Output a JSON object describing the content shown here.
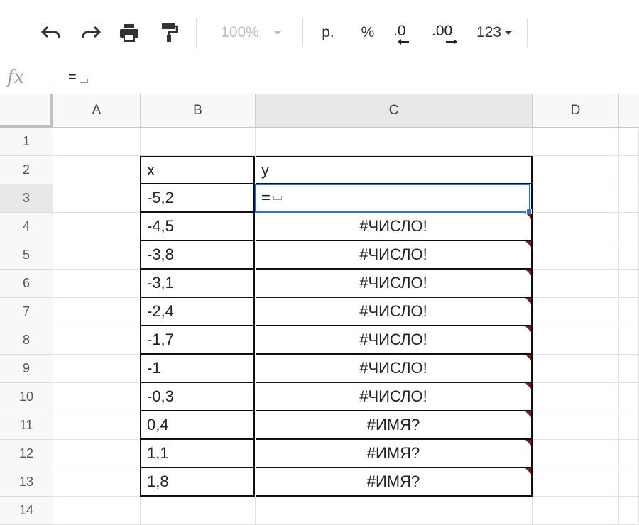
{
  "toolbar": {
    "undo_icon": "undo-icon",
    "redo_icon": "redo-icon",
    "print_icon": "print-icon",
    "paint_format_icon": "paint-format-icon",
    "zoom_label": "100%",
    "currency_label": "р.",
    "percent_label": "%",
    "decrease_decimal_label": ".0",
    "increase_decimal_label": ".00",
    "more_formats_label": "123"
  },
  "formula_bar": {
    "fx_label": "fx",
    "content": "="
  },
  "columns": [
    "A",
    "B",
    "C",
    "D"
  ],
  "rows": [
    "1",
    "2",
    "3",
    "4",
    "5",
    "6",
    "7",
    "8",
    "9",
    "10",
    "11",
    "12",
    "13",
    "14"
  ],
  "table": {
    "header_x": "x",
    "header_y": "y",
    "x_values": [
      "-5,2",
      "-4,5",
      "-3,8",
      "-3,1",
      "-2,4",
      "-1,7",
      "-1",
      "-0,3",
      "0,4",
      "1,1",
      "1,8"
    ],
    "y_values": [
      "=",
      "#ЧИСЛО!",
      "#ЧИСЛО!",
      "#ЧИСЛО!",
      "#ЧИСЛО!",
      "#ЧИСЛО!",
      "#ЧИСЛО!",
      "#ЧИСЛО!",
      "#ИМЯ?",
      "#ИМЯ?",
      "#ИМЯ?"
    ]
  },
  "colors": {
    "selection": "#2a6fdb",
    "error_marker": "#8b1a1a",
    "table_border": "#111111"
  }
}
